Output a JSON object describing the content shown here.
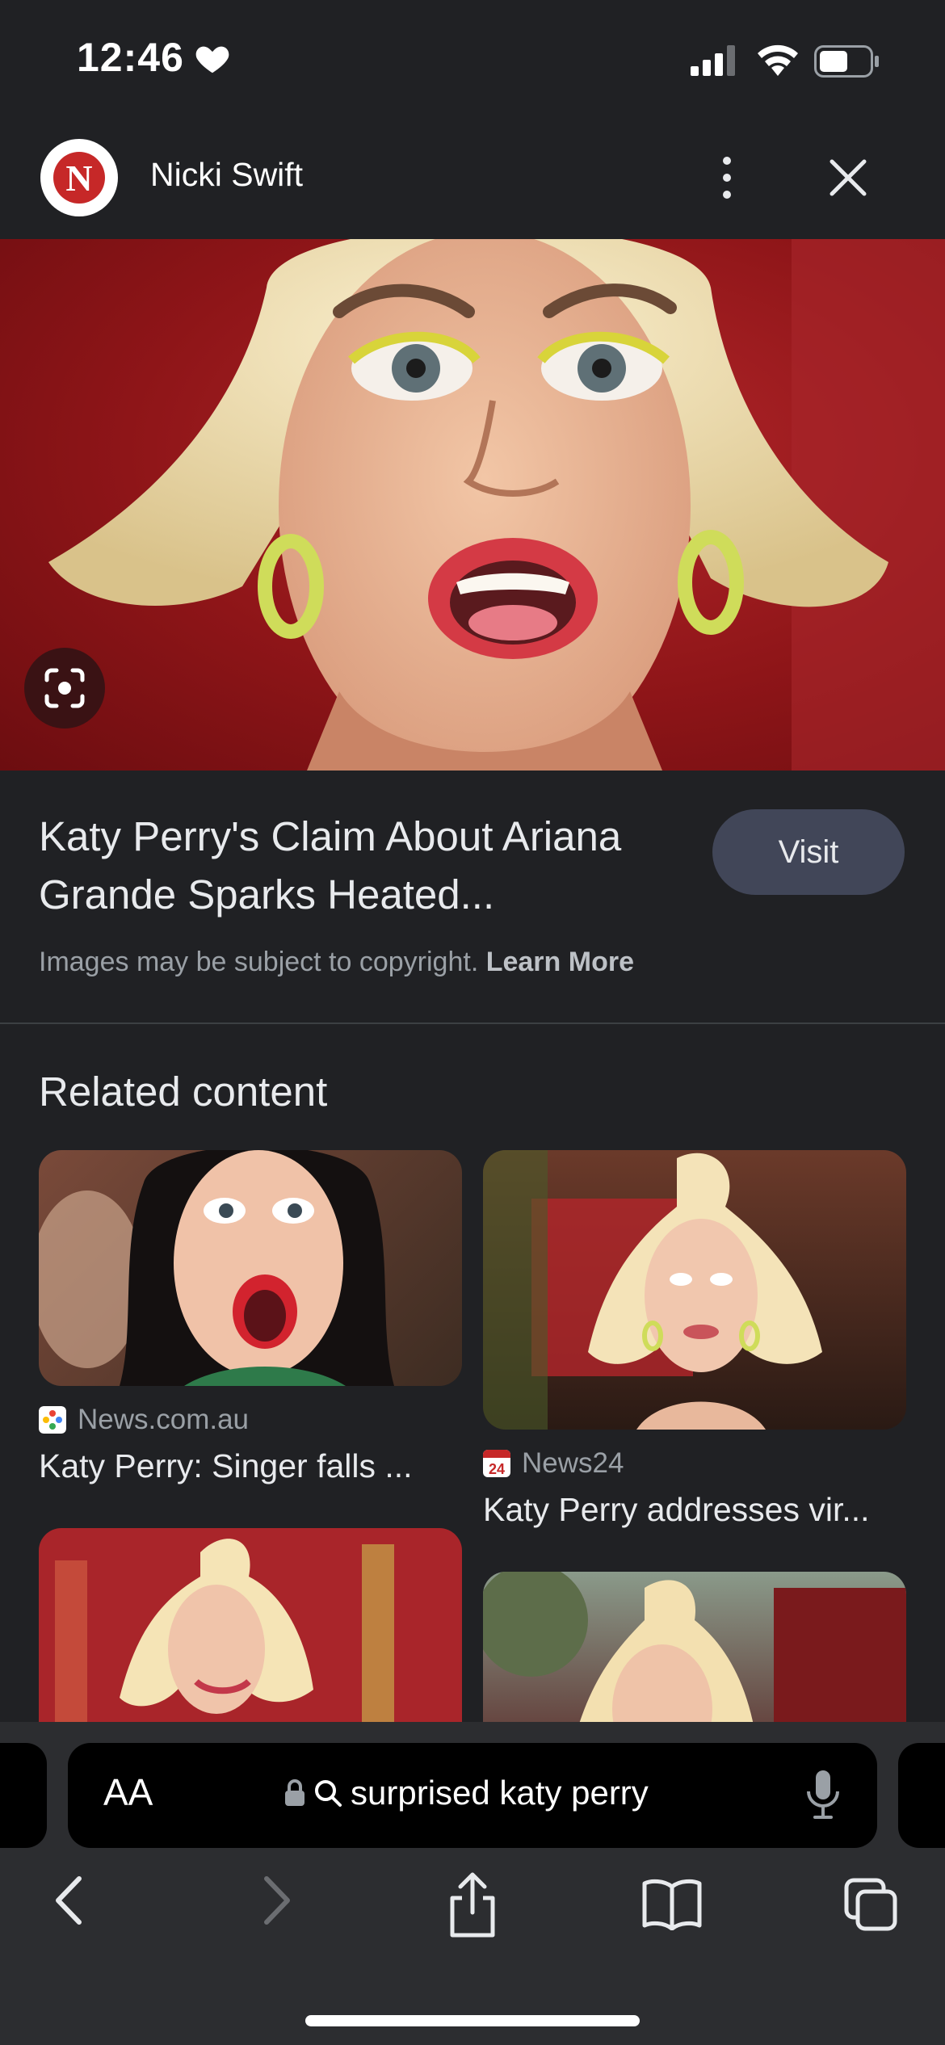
{
  "status_bar": {
    "time": "12:46"
  },
  "source": {
    "logo_letter": "N",
    "name": "Nicki Swift"
  },
  "result": {
    "title": "Katy Perry's Claim About Ariana Grande Sparks Heated...",
    "visit_label": "Visit",
    "copyright_text": "Images may be subject to copyright.",
    "learn_more_label": "Learn More"
  },
  "related": {
    "heading": "Related content",
    "items": [
      {
        "source": "News.com.au",
        "title": "Katy Perry: Singer falls ..."
      },
      {
        "source": "News24",
        "title": "Katy Perry addresses vir..."
      }
    ]
  },
  "browser": {
    "text_size_label": "AA",
    "query": "surprised katy perry"
  },
  "colors": {
    "background": "#202124",
    "visit_button": "#414658",
    "toolbar": "#2c2d30",
    "brand_red": "#c62828"
  },
  "icons": [
    "heart-icon",
    "signal-icon",
    "wifi-icon",
    "battery-icon",
    "more-vert-icon",
    "close-icon",
    "lens-icon",
    "lock-icon",
    "search-icon",
    "mic-icon",
    "back-icon",
    "forward-icon",
    "share-icon",
    "bookmarks-icon",
    "tabs-icon"
  ]
}
